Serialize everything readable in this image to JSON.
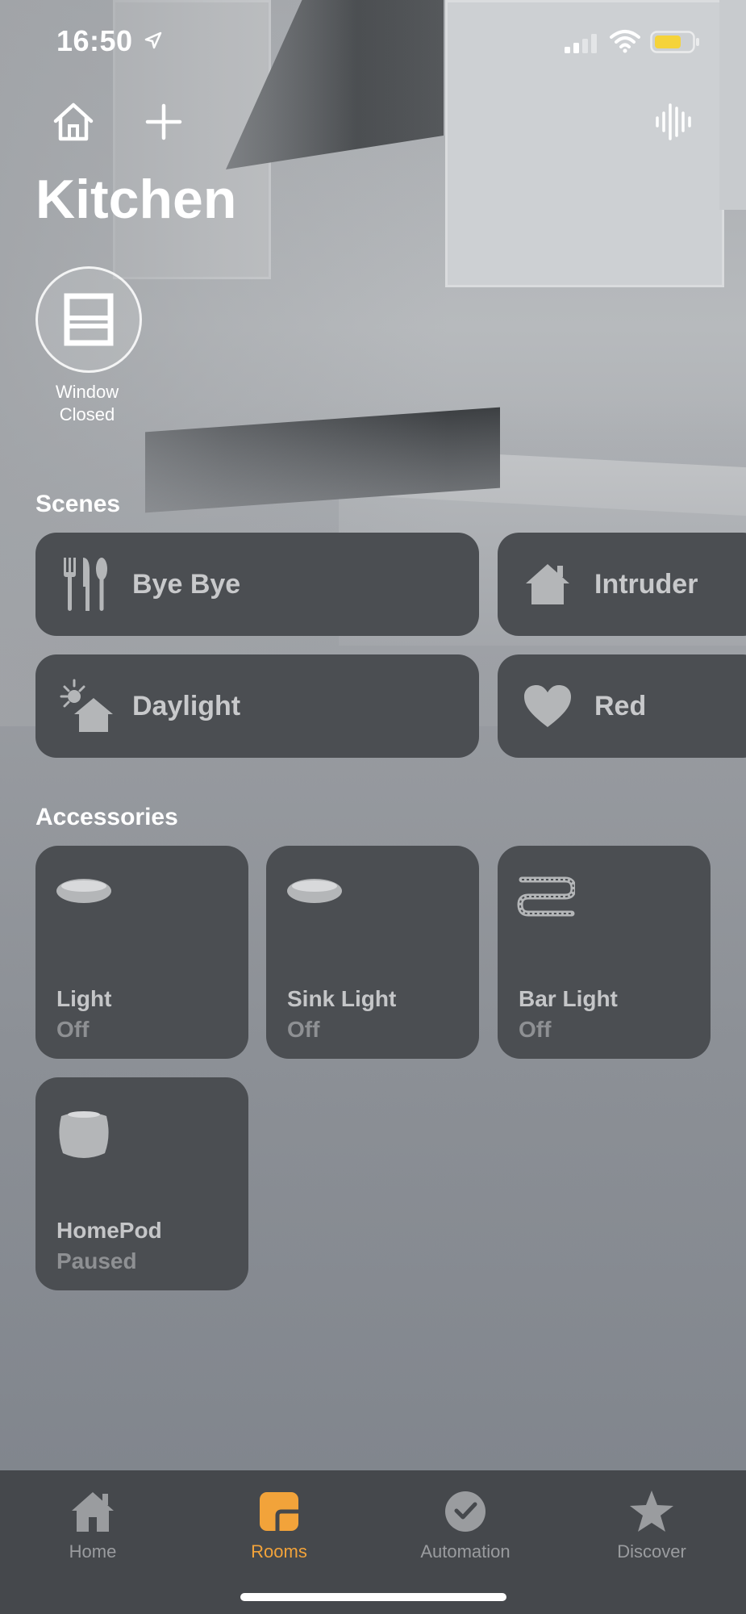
{
  "status_bar": {
    "time": "16:50"
  },
  "header": {
    "title": "Kitchen"
  },
  "status_tile": {
    "line1": "Window",
    "line2": "Closed"
  },
  "sections": {
    "scenes": "Scenes",
    "accessories": "Accessories"
  },
  "scenes": [
    {
      "label": "Bye Bye",
      "icon": "utensils-icon"
    },
    {
      "label": "Intruder",
      "icon": "house-icon"
    },
    {
      "label": "Daylight",
      "icon": "sun-house-icon"
    },
    {
      "label": "Red",
      "icon": "heart-icon"
    }
  ],
  "accessories": [
    {
      "name": "Light",
      "state": "Off",
      "icon": "ceiling-light-icon"
    },
    {
      "name": "Sink Light",
      "state": "Off",
      "icon": "ceiling-light-icon"
    },
    {
      "name": "Bar Light",
      "state": "Off",
      "icon": "light-strip-icon"
    },
    {
      "name": "HomePod",
      "state": "Paused",
      "icon": "homepod-icon"
    }
  ],
  "tabs": [
    {
      "label": "Home",
      "icon": "home-icon"
    },
    {
      "label": "Rooms",
      "icon": "rooms-icon",
      "active": true
    },
    {
      "label": "Automation",
      "icon": "automation-icon"
    },
    {
      "label": "Discover",
      "icon": "star-icon"
    }
  ],
  "colors": {
    "accent": "#f2a33a",
    "tile": "#4b4e52",
    "tabbar": "#45484c",
    "battery": "#f5d33a"
  }
}
